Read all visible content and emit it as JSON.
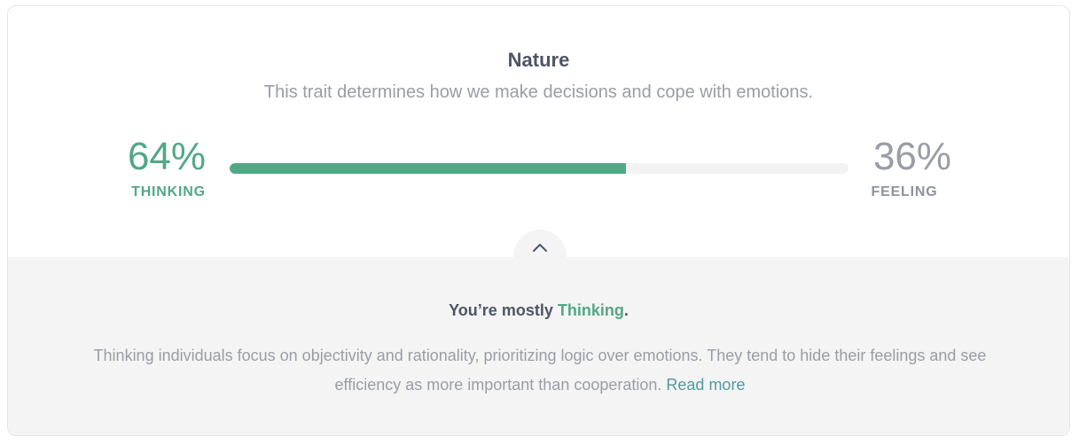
{
  "trait": {
    "title": "Nature",
    "subtitle": "This trait determines how we make decisions and cope with emotions."
  },
  "left": {
    "percent_label": "64%",
    "percent_value": 64,
    "label": "THINKING",
    "color": "#51a886"
  },
  "right": {
    "percent_label": "36%",
    "percent_value": 36,
    "label": "FEELING",
    "color": "#9a9da6"
  },
  "toggle": {
    "icon": "chevron-up-icon"
  },
  "summary": {
    "prefix": "You’re mostly ",
    "type": "Thinking",
    "suffix": ".",
    "description": "Thinking individuals focus on objectivity and rationality, prioritizing logic over emotions. They tend to hide their feelings and see efficiency as more important than cooperation. ",
    "read_more": "Read more"
  }
}
